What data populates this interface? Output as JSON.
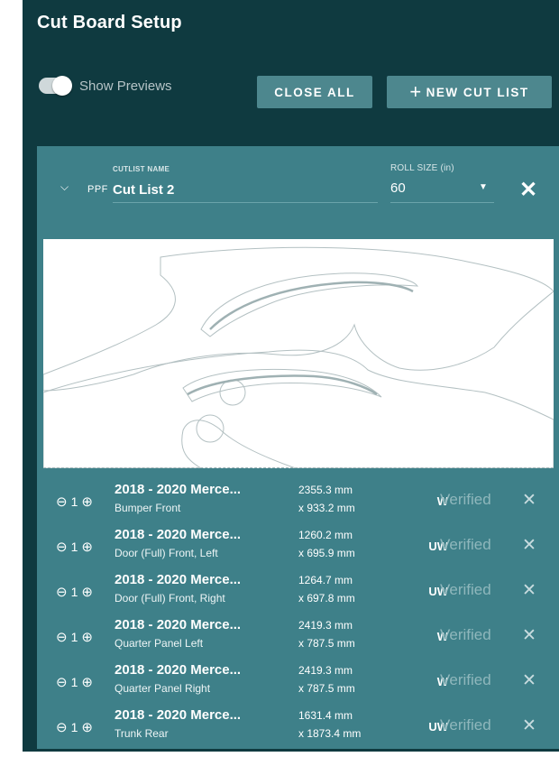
{
  "header": {
    "title": "Cut Board Setup"
  },
  "controls": {
    "toggle_label": "Show Previews",
    "toggle_on": true,
    "close_all_label": "CLOSE ALL",
    "new_cut_list_label": "NEW CUT LIST",
    "new_cut_list_icon": "plus-icon"
  },
  "cutlist": {
    "chevron_icon": "chevron-down-icon",
    "material": "PPF",
    "name_label": "CUTLIST NAME",
    "name": "Cut List 2",
    "roll_label": "ROLL SIZE (in)",
    "roll_value": "60",
    "close_icon": "close-icon"
  },
  "items": [
    {
      "qty": "1",
      "title": "2018 - 2020 Merce...",
      "subtitle": "Bumper Front",
      "dim1": "2355.3 mm",
      "dim2": "x 933.2 mm",
      "type": "W",
      "status": "Verified"
    },
    {
      "qty": "1",
      "title": "2018 - 2020 Merce...",
      "subtitle": "Door (Full) Front, Left",
      "dim1": "1260.2 mm",
      "dim2": "x 695.9 mm",
      "type": "UW",
      "status": "Verified"
    },
    {
      "qty": "1",
      "title": "2018 - 2020 Merce...",
      "subtitle": "Door (Full) Front, Right",
      "dim1": "1264.7 mm",
      "dim2": "x 697.8 mm",
      "type": "UW",
      "status": "Verified"
    },
    {
      "qty": "1",
      "title": "2018 - 2020 Merce...",
      "subtitle": "Quarter Panel Left",
      "dim1": "2419.3 mm",
      "dim2": "x 787.5 mm",
      "type": "W",
      "status": "Verified"
    },
    {
      "qty": "1",
      "title": "2018 - 2020 Merce...",
      "subtitle": "Quarter Panel Right",
      "dim1": "2419.3 mm",
      "dim2": "x 787.5 mm",
      "type": "W",
      "status": "Verified"
    },
    {
      "qty": "1",
      "title": "2018 - 2020 Merce...",
      "subtitle": "Trunk Rear",
      "dim1": "1631.4 mm",
      "dim2": "x 1873.4 mm",
      "type": "UW",
      "status": "Verified"
    }
  ],
  "colors": {
    "background": "#0f3a40",
    "panel": "#3e8089",
    "button": "#4d878e",
    "status_text": "#8fb7bc"
  }
}
